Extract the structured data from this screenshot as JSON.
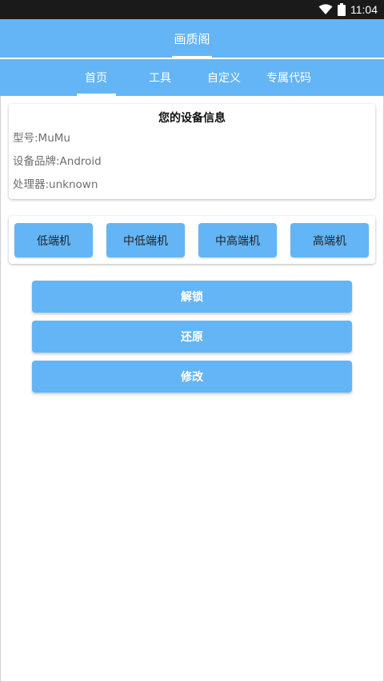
{
  "status_bar": {
    "time": "11:04",
    "icons": [
      "wifi-icon",
      "battery-icon"
    ]
  },
  "app_bar": {
    "title": "画质阁"
  },
  "tabs": [
    {
      "label": "首页",
      "selected": true
    },
    {
      "label": "工具",
      "selected": false
    },
    {
      "label": "自定义",
      "selected": false
    },
    {
      "label": "专属代码",
      "selected": false
    }
  ],
  "device_info": {
    "title": "您的设备信息",
    "model": "型号:MuMu",
    "brand": "设备品牌:Android",
    "processor": "处理器:unknown"
  },
  "tiers": [
    {
      "label": "低端机"
    },
    {
      "label": "中低端机"
    },
    {
      "label": "中高端机"
    },
    {
      "label": "高端机"
    }
  ],
  "actions": {
    "unlock": "解锁",
    "restore": "还原",
    "modify": "修改"
  },
  "colors": {
    "accent": "#64b5f6",
    "status_bar": "#1a1a1a"
  }
}
